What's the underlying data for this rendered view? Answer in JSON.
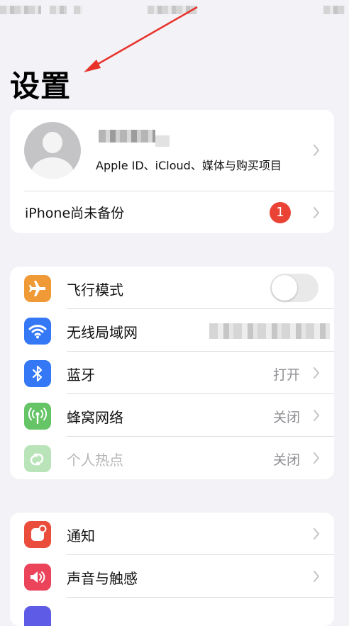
{
  "page": {
    "title": "设置"
  },
  "account": {
    "subtitle": "Apple ID、iCloud、媒体与购买项目",
    "backup_label": "iPhone尚未备份",
    "backup_badge": "1"
  },
  "connectivity": {
    "items": [
      {
        "label": "飞行模式",
        "icon": "airplane-icon",
        "icon_color": "#f09a37",
        "toggle_on": false
      },
      {
        "label": "无线局域网",
        "icon": "wifi-icon",
        "icon_color": "#3478f6"
      },
      {
        "label": "蓝牙",
        "icon": "bluetooth-icon",
        "icon_color": "#3478f6",
        "value": "打开"
      },
      {
        "label": "蜂窝网络",
        "icon": "cellular-icon",
        "icon_color": "#65c466",
        "value": "关闭"
      },
      {
        "label": "个人热点",
        "icon": "hotspot-icon",
        "icon_color": "#65c466",
        "value": "关闭"
      }
    ]
  },
  "notifications": {
    "items": [
      {
        "label": "通知",
        "icon": "notification-icon",
        "icon_color": "#eb4d3d"
      },
      {
        "label": "声音与触感",
        "icon": "sound-icon",
        "icon_color": "#eb445a"
      }
    ]
  },
  "colors": {
    "background": "#f2f2f7",
    "badge": "#ea4335",
    "annotation_arrow": "#e8322a"
  }
}
